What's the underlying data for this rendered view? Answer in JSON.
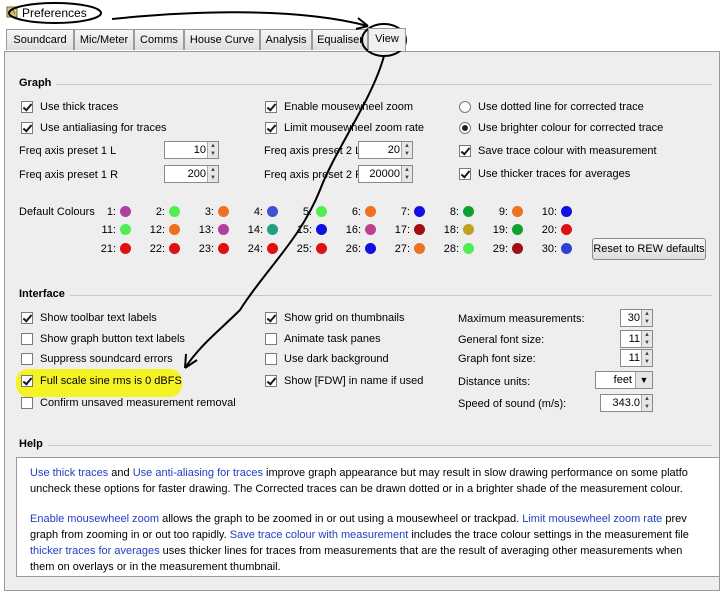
{
  "window": {
    "title": "Preferences"
  },
  "tabs": [
    {
      "label": "Soundcard"
    },
    {
      "label": "Mic/Meter"
    },
    {
      "label": "Comms"
    },
    {
      "label": "House Curve"
    },
    {
      "label": "Analysis"
    },
    {
      "label": "Equaliser"
    },
    {
      "label": "View"
    }
  ],
  "active_tab": "View",
  "graph": {
    "heading": "Graph",
    "use_thick_traces": "Use thick traces",
    "use_antialiasing": "Use antialiasing for traces",
    "enable_mousewheel_zoom": "Enable mousewheel zoom",
    "limit_mousewheel_zoom": "Limit mousewheel zoom rate",
    "dotted_line": "Use dotted line for corrected trace",
    "brighter_colour": "Use brighter colour for corrected trace",
    "save_trace_colour": "Save trace colour with measurement",
    "thicker_traces_avg": "Use thicker traces for averages",
    "freq_1l_label": "Freq axis preset 1 L",
    "freq_1l_value": "10",
    "freq_1r_label": "Freq axis preset 1 R",
    "freq_1r_value": "200",
    "freq_2l_label": "Freq axis preset 2 L",
    "freq_2l_value": "20",
    "freq_2r_label": "Freq axis preset 2 R",
    "freq_2r_value": "20000",
    "default_colours_label": "Default Colours",
    "reset_button": "Reset to REW defaults",
    "colour_numbers": [
      "1:",
      "2:",
      "3:",
      "4:",
      "5:",
      "6:",
      "7:",
      "8:",
      "9:",
      "10:",
      "11:",
      "12:",
      "13:",
      "14:",
      "15:",
      "16:",
      "17:",
      "18:",
      "19:",
      "20:",
      "21:",
      "22:",
      "23:",
      "24:",
      "25:",
      "26:",
      "27:",
      "28:",
      "29:",
      "30:"
    ],
    "colour_values": [
      "#b040a0",
      "#50ee50",
      "#ee7020",
      "#4050d0",
      "#50ee50",
      "#ee7020",
      "#1010e0",
      "#10a030",
      "#ee7020",
      "#1010e0",
      "#50ee50",
      "#ee7020",
      "#b040a0",
      "#20a080",
      "#1010e0",
      "#c04090",
      "#a01010",
      "#c0a020",
      "#10a030",
      "#e01010",
      "#e01010",
      "#e01010",
      "#e01010",
      "#e01010",
      "#e01010",
      "#1010e0",
      "#ee7020",
      "#50ee50",
      "#a01010",
      "#3040d0"
    ]
  },
  "interface": {
    "heading": "Interface",
    "show_toolbar_text": "Show toolbar text labels",
    "show_graph_button_text": "Show graph button text labels",
    "suppress_soundcard_errors": "Suppress soundcard errors",
    "full_scale_sine": "Full scale sine rms is 0 dBFS",
    "confirm_unsaved": "Confirm unsaved measurement removal",
    "show_grid_thumbnails": "Show grid on thumbnails",
    "animate_task_panes": "Animate task panes",
    "use_dark_background": "Use dark background",
    "show_fdw": "Show [FDW] in name if used",
    "max_measurements_label": "Maximum measurements:",
    "max_measurements_value": "30",
    "general_font_label": "General font size:",
    "general_font_value": "11",
    "graph_font_label": "Graph font size:",
    "graph_font_value": "11",
    "distance_units_label": "Distance units:",
    "distance_units_value": "feet",
    "speed_of_sound_label": "Speed of sound (m/s):",
    "speed_of_sound_value": "343.0"
  },
  "help": {
    "heading": "Help",
    "p1_l1_a": "Use thick traces",
    "p1_l1_b": " and ",
    "p1_l1_c": "Use anti-aliasing for traces",
    "p1_l1_d": " improve graph appearance but may result in slow drawing performance on some platfo",
    "p1_l2": "uncheck these options for faster drawing. The Corrected traces can be drawn dotted or in a brighter shade of the measurement colour.",
    "p2_l1_a": "Enable mousewheel zoom",
    "p2_l1_b": " allows the graph to be zoomed in or out using a mousewheel or trackpad. ",
    "p2_l1_c": "Limit mousewheel zoom rate",
    "p2_l1_d": " prev",
    "p2_l2_a": "graph from zooming in or out too rapidly. ",
    "p2_l2_b": "Save trace colour with measurement",
    "p2_l2_c": " includes the trace colour settings in the measurement file",
    "p2_l3_a": "thicker traces for averages",
    "p2_l3_b": " uses thicker lines for traces from measurements that are the result of averaging other measurements when",
    "p2_l4": "them on overlays or in the measurement thumbnail."
  },
  "colors": {
    "panel": "#eeeeee",
    "highlight": "#f4f400",
    "link": "#2040c0",
    "annotation": "#000000"
  }
}
